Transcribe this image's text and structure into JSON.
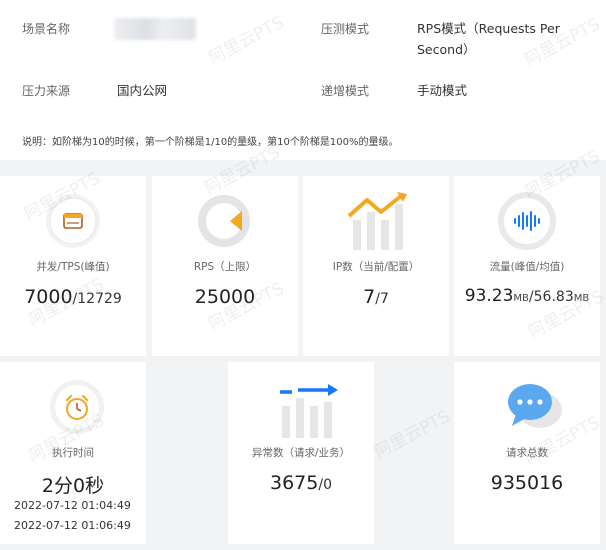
{
  "info": {
    "scene_label": "场景名称",
    "pressure_mode_label": "压测模式",
    "pressure_mode_value_line1": "RPS模式（Requests Per",
    "pressure_mode_value_line2": "Second）",
    "source_label": "压力来源",
    "source_value": "国内公网",
    "ramp_label": "递增模式",
    "ramp_value": "手动模式",
    "note": "说明：如阶梯为10的时候，第一个阶梯是1/10的量级，第10个阶梯是100%的量级。"
  },
  "cards": {
    "concurrency": {
      "caption": "并发/TPS(峰值)",
      "main": "7000",
      "sep": "/",
      "sub": "12729"
    },
    "rps": {
      "caption": "RPS（上限）",
      "main": "25000"
    },
    "ip": {
      "caption": "IP数（当前/配置）",
      "main": "7",
      "sep": "/",
      "sub": "7"
    },
    "traffic": {
      "caption": "流量(峰值/均值)",
      "main": "93.23",
      "unit1": "MB",
      "sep": "/",
      "sub": "56.83",
      "unit2": "MB"
    },
    "duration": {
      "caption": "执行时间",
      "main": "2分0秒",
      "start": "2022-07-12 01:04:49",
      "end": "2022-07-12 01:06:49"
    },
    "errors": {
      "caption": "异常数（请求/业务）",
      "main": "3675",
      "sep": "/",
      "sub": "0"
    },
    "total": {
      "caption": "请求总数",
      "main": "935016"
    }
  },
  "watermark": "阿里云PTS",
  "colors": {
    "accent_orange": "#f5a623",
    "accent_blue": "#1677ff",
    "ring_gray": "#e8e8e8"
  },
  "icons": [
    "wallet-icon",
    "gauge-icon",
    "trend-bars-icon",
    "waveform-icon",
    "alarm-clock-icon",
    "error-bars-icon",
    "chat-bubble-icon"
  ]
}
